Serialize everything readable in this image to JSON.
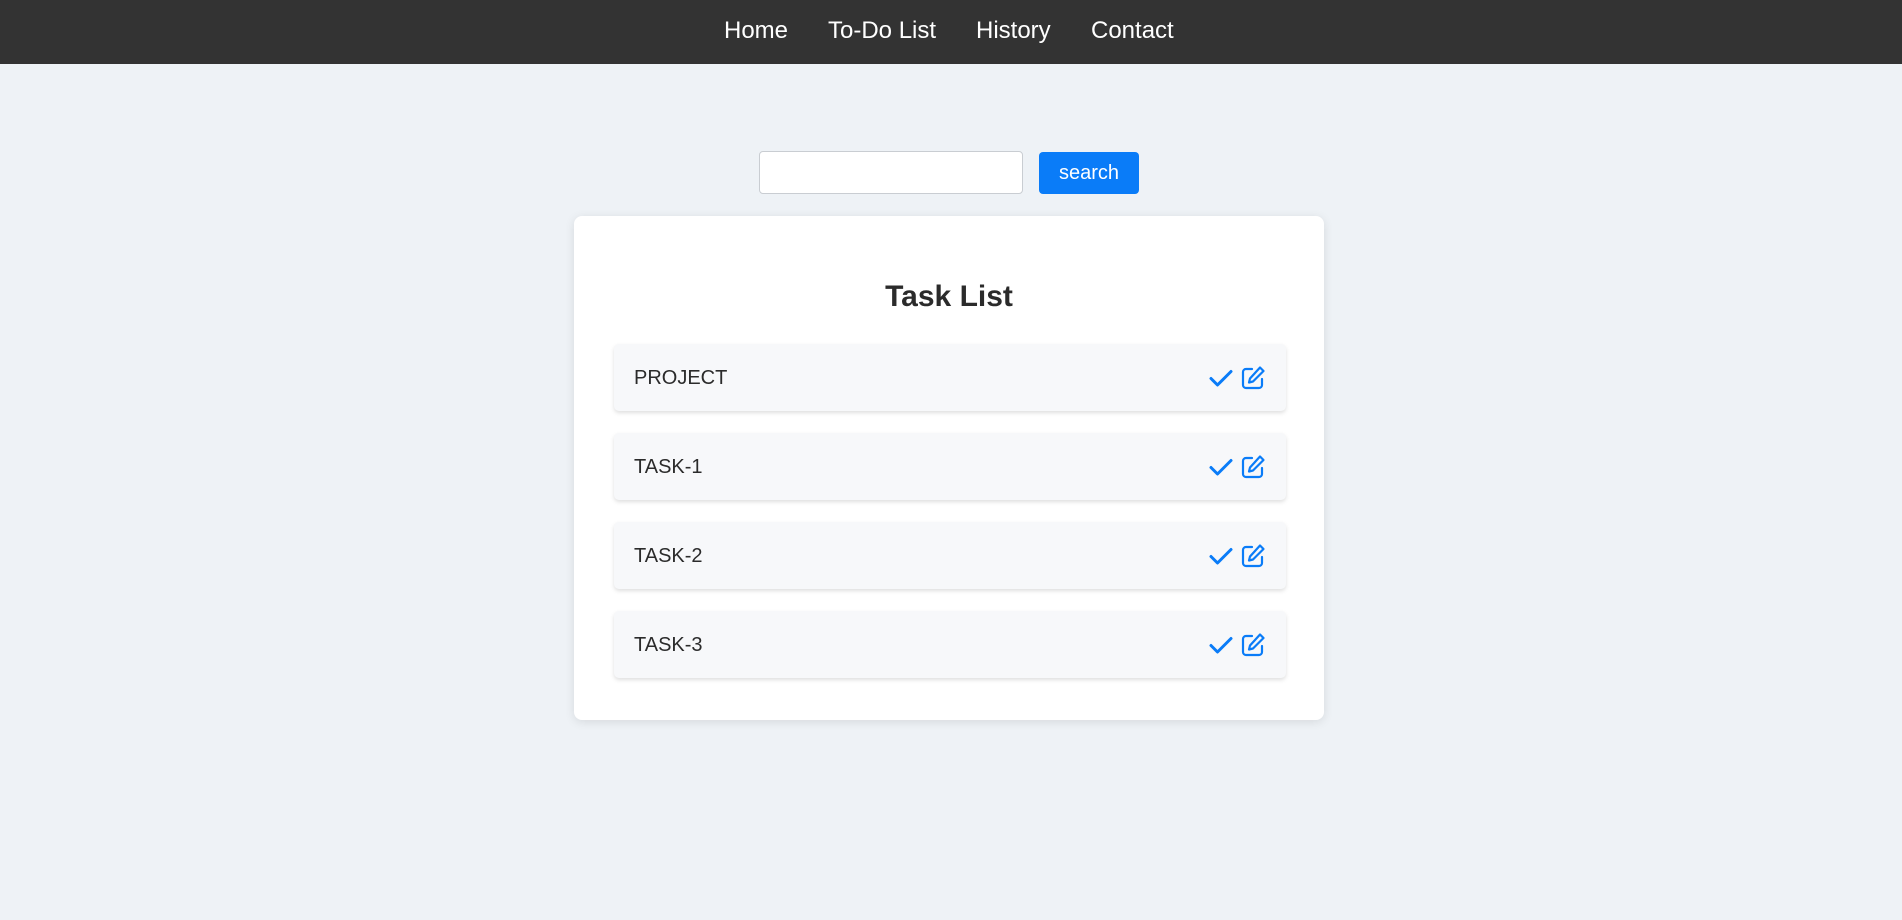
{
  "nav": {
    "items": [
      {
        "label": "Home"
      },
      {
        "label": "To-Do List"
      },
      {
        "label": "History"
      },
      {
        "label": "Contact"
      }
    ]
  },
  "search": {
    "value": "",
    "button_label": "search"
  },
  "task_list": {
    "title": "Task List",
    "tasks": [
      {
        "label": "PROJECT",
        "complete_icon": "check-icon",
        "edit_icon": "edit-icon"
      },
      {
        "label": "TASK-1",
        "complete_icon": "check-icon",
        "edit_icon": "edit-icon"
      },
      {
        "label": "TASK-2",
        "complete_icon": "check-icon",
        "edit_icon": "edit-icon"
      },
      {
        "label": "TASK-3",
        "complete_icon": "check-icon",
        "edit_icon": "edit-icon"
      }
    ]
  },
  "colors": {
    "navbar": "#333333",
    "accent": "#0a7cf8",
    "background": "#eef2f6"
  }
}
